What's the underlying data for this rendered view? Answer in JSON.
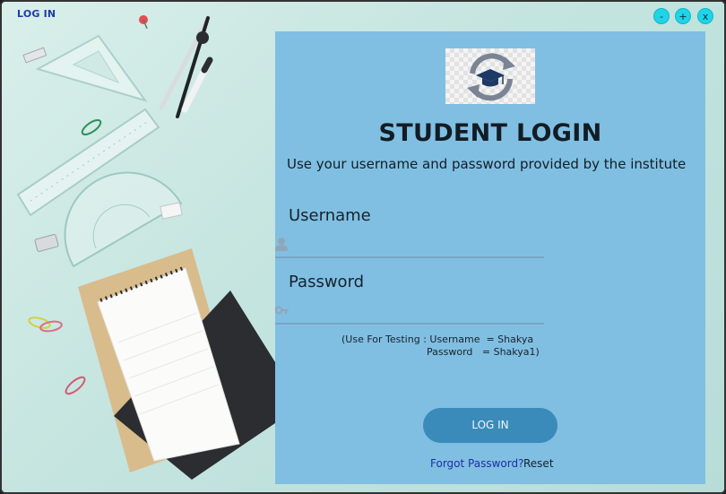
{
  "window": {
    "title": "LOG IN",
    "minimize_label": "-",
    "maximize_label": "+",
    "close_label": "x"
  },
  "login": {
    "heading": "STUDENT LOGIN",
    "subtitle": "Use your username and password provided by the institute",
    "username_label": "Username",
    "username_value": "",
    "password_label": "Password",
    "password_value": "",
    "hint_line1": "(Use For Testing : Username  = Shakya",
    "hint_line2": "Password   = Shakya1)",
    "login_button": "LOG IN",
    "forgot_link": "Forgot Password?",
    "reset_link": "Reset"
  },
  "colors": {
    "panel": "#80bfe2",
    "button": "#3a8bb9",
    "window_buttons": "#1fd4e6",
    "link_forgot": "#1d2fa0"
  },
  "icons": {
    "logo": "graduation-cap-refresh-icon",
    "username": "user-icon",
    "password": "key-icon"
  }
}
